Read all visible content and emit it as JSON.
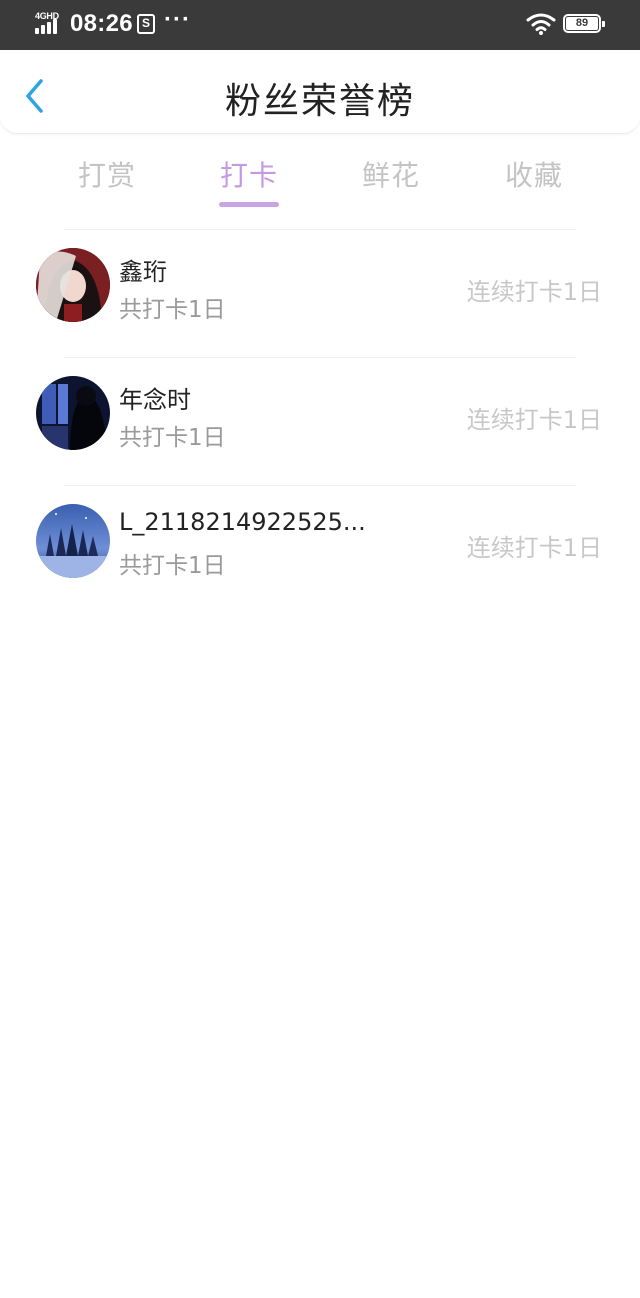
{
  "status_bar": {
    "network": "4GHD",
    "time": "08:26",
    "app_icon_glyph": "S",
    "more": "···",
    "battery": "89"
  },
  "header": {
    "back_icon": "chevron-left-icon",
    "title": "粉丝荣誉榜"
  },
  "tabs": [
    {
      "label": "打赏",
      "active": false
    },
    {
      "label": "打卡",
      "active": true
    },
    {
      "label": "鲜花",
      "active": false
    },
    {
      "label": "收藏",
      "active": false
    }
  ],
  "fans": [
    {
      "name": "鑫珩",
      "total": "共打卡1日",
      "streak": "连续打卡1日",
      "avatar": "avatar-girl-red"
    },
    {
      "name": "年念时",
      "total": "共打卡1日",
      "streak": "连续打卡1日",
      "avatar": "avatar-dark-window"
    },
    {
      "name": "L_2118214922525...",
      "total": "共打卡1日",
      "streak": "连续打卡1日",
      "avatar": "avatar-blue-trees"
    }
  ],
  "colors": {
    "status_bar_bg": "#3a3a3a",
    "accent": "#c49be0",
    "back_arrow": "#2ea3e6",
    "muted_text": "#9a9a9a",
    "streak_text": "#c8c8c8"
  }
}
